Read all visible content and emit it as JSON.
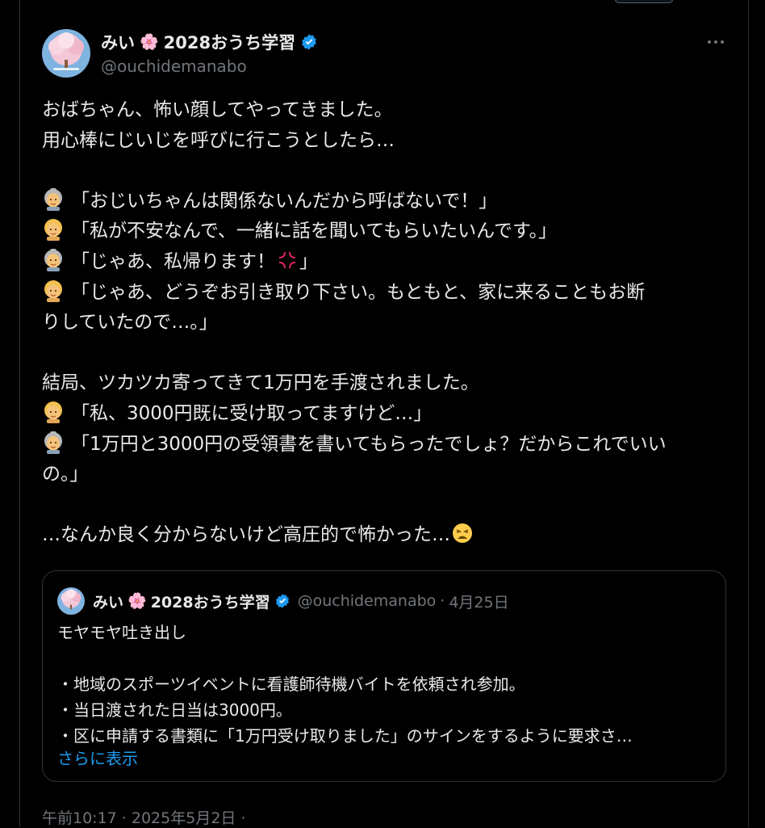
{
  "post": {
    "author": {
      "display_name": "みい",
      "display_name_suffix": "2028おうち学習",
      "handle": "@ouchidemanabo",
      "verified": true,
      "name_emoji": "cherry-blossom"
    },
    "lines": [
      {
        "text": "おばちゃん、怖い顔してやってきました。"
      },
      {
        "text": "用心棒にじいじを呼びに行こうとしたら…"
      },
      {
        "text": ""
      },
      {
        "speaker": "older-woman",
        "text": "「おじいちゃんは関係ないんだから呼ばないで！」"
      },
      {
        "speaker": "woman",
        "text": "「私が不安なんで、一緒に話を聞いてもらいたいんです。」"
      },
      {
        "speaker": "older-woman",
        "text": "「じゃあ、私帰ります！",
        "after_emoji": "anger",
        "after_text": "」"
      },
      {
        "speaker": "woman",
        "text": "「じゃあ、どうぞお引き取り下さい。もともと、家に来ることもお断"
      },
      {
        "text": "りしていたので…。」"
      },
      {
        "text": ""
      },
      {
        "text": "結局、ツカツカ寄ってきて1万円を手渡されました。"
      },
      {
        "speaker": "woman",
        "text": "「私、3000円既に受け取ってますけど…」"
      },
      {
        "speaker": "older-woman",
        "text": "「1万円と3000円の受領書を書いてもらったでしょ？だからこれでいい"
      },
      {
        "text": "の。」"
      },
      {
        "text": ""
      },
      {
        "text": "…なんか良く分からないけど高圧的で怖かった…",
        "after_emoji": "weary"
      }
    ],
    "timestamp": "午前10:17 · 2025年5月2日 ·"
  },
  "quote": {
    "display_name": "みい",
    "display_name_suffix": "2028おうち学習",
    "handle": "@ouchidemanabo",
    "date": "4月25日",
    "separator": "·",
    "lines": [
      "モヤモヤ吐き出し",
      "",
      "・地域のスポーツイベントに看護師待機バイトを依頼され参加。",
      "・当日渡された日当は3000円。",
      "・区に申請する書類に「1万円受け取りました」のサインをするように要求さ…"
    ],
    "show_more": "さらに表示"
  },
  "colors": {
    "background": "#000000",
    "text": "#e7e9ea",
    "muted": "#71767b",
    "accent": "#1d9bf0",
    "border": "#2f3336"
  }
}
